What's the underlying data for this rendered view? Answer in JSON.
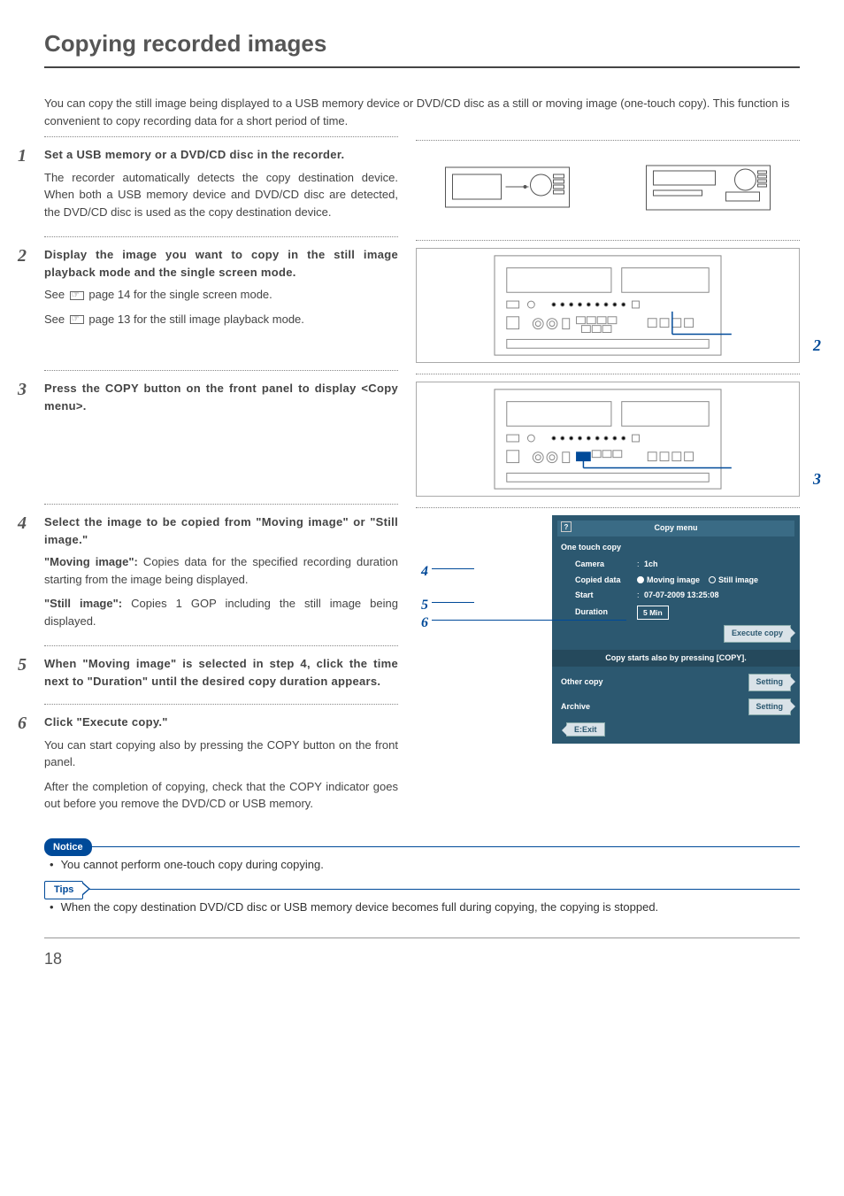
{
  "page": {
    "title": "Copying recorded images",
    "intro": "You can copy the still image being displayed to a USB memory device or DVD/CD disc as a still or moving image (one-touch copy). This function is convenient to copy recording data for a short period of time.",
    "number": "18"
  },
  "steps": {
    "s1": {
      "num": "1",
      "head": "Set a USB memory or a DVD/CD disc in the recorder.",
      "body": "The recorder automatically detects the copy destination device. When both a USB memory device and DVD/CD disc are detected, the DVD/CD disc is used as the copy destination device."
    },
    "s2": {
      "num": "2",
      "head": "Display the image you want to copy in the still image playback mode and the single screen mode.",
      "ref1_a": "See ",
      "ref1_b": " page 14 for the single screen mode.",
      "ref2_a": "See ",
      "ref2_b": " page 13 for the still image playback mode.",
      "callout": "2"
    },
    "s3": {
      "num": "3",
      "head": "Press the COPY button on the front panel to display <Copy menu>.",
      "callout": "3"
    },
    "s4": {
      "num": "4",
      "head": "Select the image to be copied from \"Moving image\" or \"Still image.\"",
      "p1_a": "\"Moving image\":",
      "p1_b": " Copies data for the specified recording duration starting from the image being displayed.",
      "p2_a": "\"Still image\":",
      "p2_b": " Copies 1 GOP including the still image being displayed."
    },
    "s5": {
      "num": "5",
      "head": "When \"Moving image\" is selected in step 4, click the time next to \"Duration\" until the desired copy duration appears."
    },
    "s6": {
      "num": "6",
      "head": "Click \"Execute copy.\"",
      "p1": "You can start copying also by pressing the COPY button on the front panel.",
      "p2": "After the completion of copying, check that the COPY indicator goes out before you remove the DVD/CD or USB memory."
    }
  },
  "copymenu": {
    "title": "Copy menu",
    "q": "?",
    "section": "One touch copy",
    "camera_label": "Camera",
    "camera_value": "1ch",
    "copied_label": "Copied data",
    "opt_moving": "Moving image",
    "opt_still": "Still image",
    "start_label": "Start",
    "start_value": "07-07-2009   13:25:08",
    "duration_label": "Duration",
    "duration_value": "5 Min",
    "exec": "Execute copy",
    "note": "Copy starts also by pressing [COPY].",
    "other": "Other copy",
    "archive": "Archive",
    "setting": "Setting",
    "exit": "E:Exit",
    "callouts": {
      "c4": "4",
      "c5": "5",
      "c6": "6"
    }
  },
  "notice": {
    "label": "Notice",
    "item": "You cannot perform one-touch copy during copying."
  },
  "tips": {
    "label": "Tips",
    "item": "When the copy destination DVD/CD disc or USB memory device becomes full during copying, the copying is stopped."
  }
}
